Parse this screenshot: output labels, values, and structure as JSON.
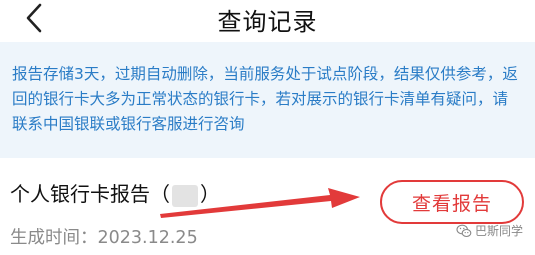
{
  "header": {
    "title": "查询记录",
    "back_icon": "chevron-left-icon"
  },
  "notice": {
    "text": "报告存储3天，过期自动删除，当前服务处于试点阶段，结果仅供参考，返回的银行卡大多为正常状态的银行卡，若对展示的银行卡清单有疑问，请联系中国银联或银行客服进行咨询"
  },
  "report": {
    "title_prefix": "个人银行卡报告（",
    "title_suffix": "）",
    "date_label": "生成时间：2023.12.25",
    "view_button_label": "查看报告"
  },
  "watermark": {
    "text": "巴斯同学",
    "icon": "wechat-icon"
  },
  "colors": {
    "accent_red": "#e23a3a",
    "notice_text": "#2a7cc6",
    "notice_bg": "#eef5fb"
  }
}
